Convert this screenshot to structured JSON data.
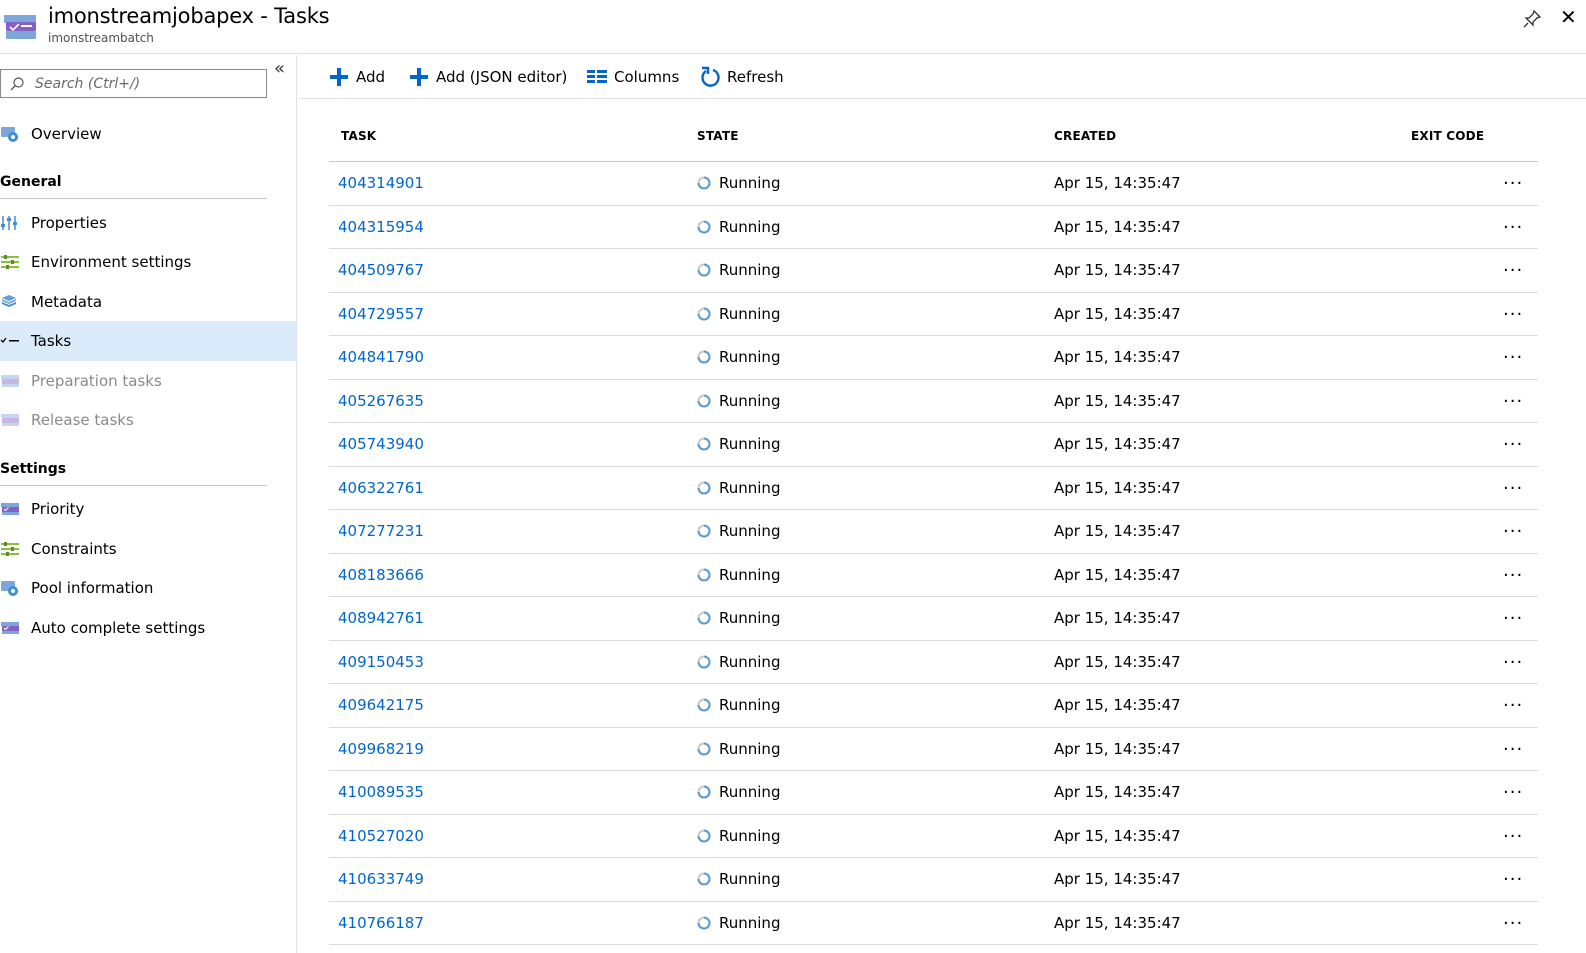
{
  "header": {
    "title": "imonstreamjobapex - Tasks",
    "subtitle": "imonstreambatch"
  },
  "search": {
    "placeholder": "Search (Ctrl+/)"
  },
  "sidebar": {
    "overview": "Overview",
    "general_label": "General",
    "general_items": [
      "Properties",
      "Environment settings",
      "Metadata",
      "Tasks",
      "Preparation tasks",
      "Release tasks"
    ],
    "settings_label": "Settings",
    "settings_items": [
      "Priority",
      "Constraints",
      "Pool information",
      "Auto complete settings"
    ],
    "selected": "Tasks"
  },
  "toolbar": {
    "add": "Add",
    "add_json": "Add (JSON editor)",
    "columns": "Columns",
    "refresh": "Refresh"
  },
  "table": {
    "headers": [
      "TASK",
      "STATE",
      "CREATED",
      "EXIT CODE"
    ],
    "rows": [
      {
        "task": "404314901",
        "state": "Running",
        "created": "Apr 15, 14:35:47"
      },
      {
        "task": "404315954",
        "state": "Running",
        "created": "Apr 15, 14:35:47"
      },
      {
        "task": "404509767",
        "state": "Running",
        "created": "Apr 15, 14:35:47"
      },
      {
        "task": "404729557",
        "state": "Running",
        "created": "Apr 15, 14:35:47"
      },
      {
        "task": "404841790",
        "state": "Running",
        "created": "Apr 15, 14:35:47"
      },
      {
        "task": "405267635",
        "state": "Running",
        "created": "Apr 15, 14:35:47"
      },
      {
        "task": "405743940",
        "state": "Running",
        "created": "Apr 15, 14:35:47"
      },
      {
        "task": "406322761",
        "state": "Running",
        "created": "Apr 15, 14:35:47"
      },
      {
        "task": "407277231",
        "state": "Running",
        "created": "Apr 15, 14:35:47"
      },
      {
        "task": "408183666",
        "state": "Running",
        "created": "Apr 15, 14:35:47"
      },
      {
        "task": "408942761",
        "state": "Running",
        "created": "Apr 15, 14:35:47"
      },
      {
        "task": "409150453",
        "state": "Running",
        "created": "Apr 15, 14:35:47"
      },
      {
        "task": "409642175",
        "state": "Running",
        "created": "Apr 15, 14:35:47"
      },
      {
        "task": "409968219",
        "state": "Running",
        "created": "Apr 15, 14:35:47"
      },
      {
        "task": "410089535",
        "state": "Running",
        "created": "Apr 15, 14:35:47"
      },
      {
        "task": "410527020",
        "state": "Running",
        "created": "Apr 15, 14:35:47"
      },
      {
        "task": "410633749",
        "state": "Running",
        "created": "Apr 15, 14:35:47"
      },
      {
        "task": "410766187",
        "state": "Running",
        "created": "Apr 15, 14:35:47"
      }
    ],
    "more_label": "..."
  },
  "colors": {
    "accent": "#0066cc",
    "selected_bg": "#dcebf9",
    "border": "#e1e1e1"
  },
  "icons": {
    "app": "batch-job-icon",
    "pin": "pin-icon",
    "close": "close-icon",
    "search": "search-icon",
    "collapse": "double-chevron-left-icon"
  }
}
